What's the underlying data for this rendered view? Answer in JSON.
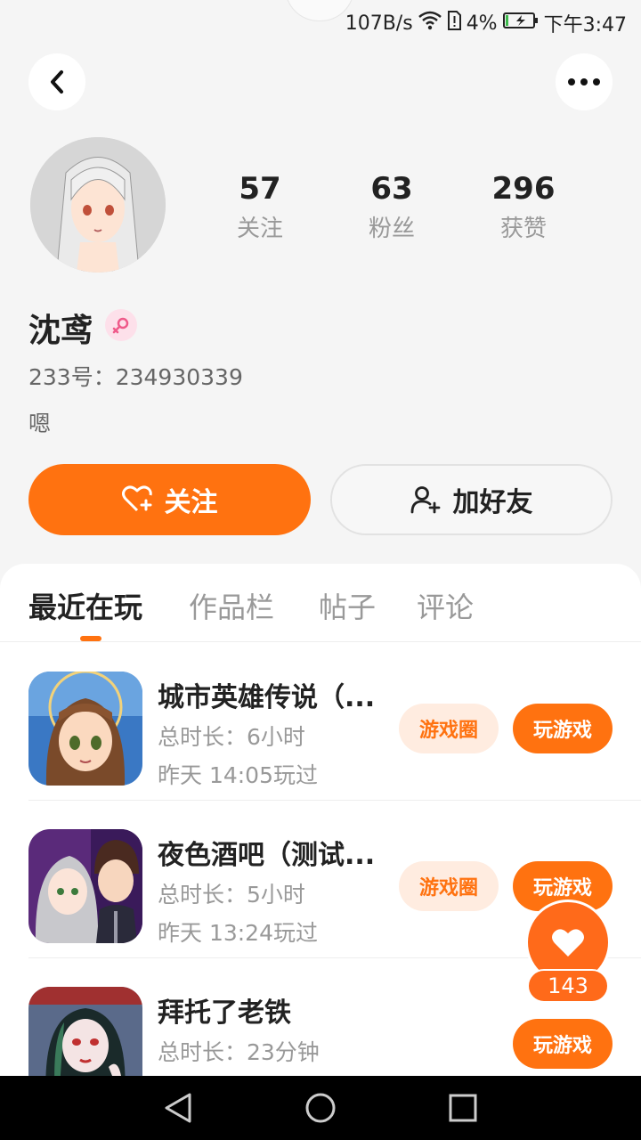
{
  "status_bar": {
    "net_speed": "107B/s",
    "battery": "4%",
    "time": "下午3:47"
  },
  "profile": {
    "stats": [
      {
        "value": "57",
        "label": "关注"
      },
      {
        "value": "63",
        "label": "粉丝"
      },
      {
        "value": "296",
        "label": "获赞"
      }
    ],
    "name": "沈鸢",
    "uid": "233号：234930339",
    "bio": "嗯"
  },
  "actions": {
    "follow_label": "关注",
    "add_friend_label": "加好友"
  },
  "tabs": [
    {
      "label": "最近在玩",
      "active": true
    },
    {
      "label": "作品栏",
      "active": false
    },
    {
      "label": "帖子",
      "active": false
    },
    {
      "label": "评论",
      "active": false
    }
  ],
  "games": [
    {
      "title": "城市英雄传说（...",
      "duration": "总时长：6小时",
      "last_played": "昨天 14:05玩过",
      "circle_label": "游戏圈",
      "play_label": "玩游戏"
    },
    {
      "title": "夜色酒吧（测试...",
      "duration": "总时长：5小时",
      "last_played": "昨天 13:24玩过",
      "circle_label": "游戏圈",
      "play_label": "玩游戏"
    },
    {
      "title": "拜托了老铁",
      "duration": "总时长：23分钟",
      "last_played": "",
      "circle_label": "",
      "play_label": "玩游戏"
    }
  ],
  "like": {
    "count": "143"
  },
  "colors": {
    "accent": "#ff7210",
    "tag_bg": "#ffece0",
    "gender_female": "#ef5a8a"
  }
}
